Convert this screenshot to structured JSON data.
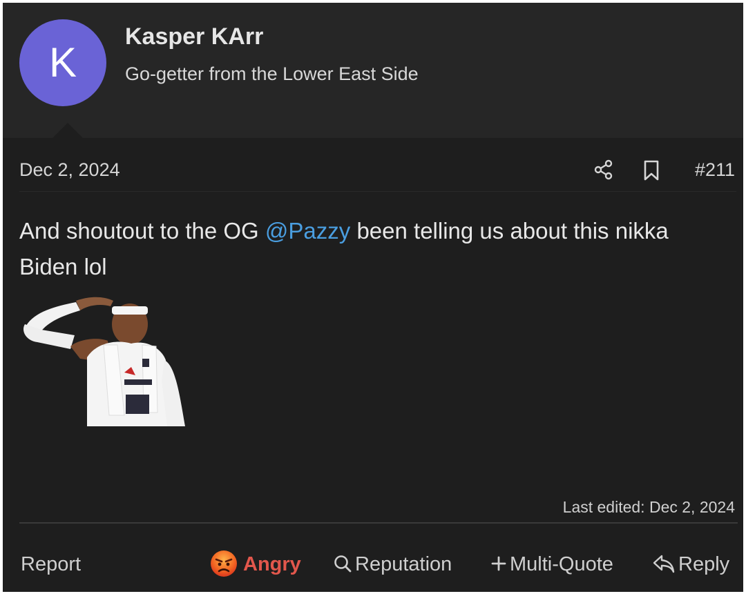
{
  "user": {
    "avatar_letter": "K",
    "name": "Kasper KArr",
    "title": "Go-getter from the Lower East Side"
  },
  "post": {
    "date": "Dec 2, 2024",
    "number": "#211",
    "body_before_mention": "And shoutout to the OG ",
    "mention": "@Pazzy",
    "body_after_mention": " been telling us about this nikka Biden lol",
    "last_edited": "Last edited: Dec 2, 2024"
  },
  "actions": {
    "report": "Report",
    "reaction": "Angry",
    "reputation": "Reputation",
    "multi_quote": "Multi-Quote",
    "reply": "Reply"
  },
  "icons": {
    "share": "share-icon",
    "bookmark": "bookmark-icon",
    "angry": "angry-face-icon",
    "search": "search-icon",
    "plus": "plus-icon",
    "reply": "reply-icon"
  },
  "colors": {
    "background": "#1e1e1e",
    "header": "#262626",
    "avatar": "#6a63d6",
    "mention": "#4a9ee0",
    "reaction": "#e2574c"
  }
}
